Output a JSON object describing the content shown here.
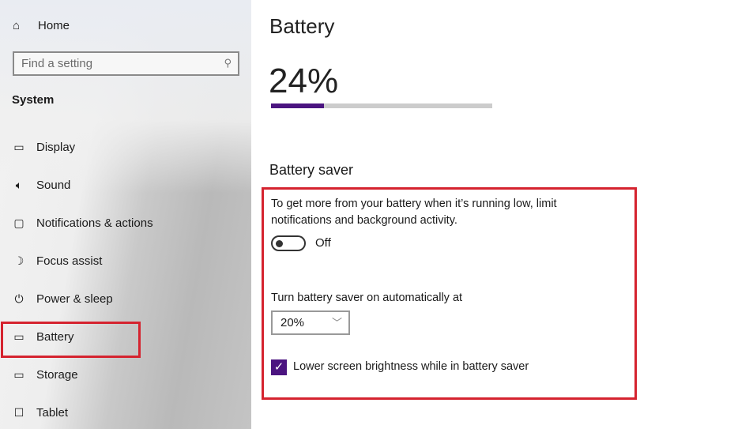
{
  "sidebar": {
    "home": "Home",
    "search_placeholder": "Find a setting",
    "section": "System",
    "items": [
      {
        "label": "Display",
        "icon": "monitor-icon"
      },
      {
        "label": "Sound",
        "icon": "speaker-icon"
      },
      {
        "label": "Notifications & actions",
        "icon": "message-icon"
      },
      {
        "label": "Focus assist",
        "icon": "moon-icon"
      },
      {
        "label": "Power & sleep",
        "icon": "power-icon"
      },
      {
        "label": "Battery",
        "icon": "battery-icon"
      },
      {
        "label": "Storage",
        "icon": "storage-icon"
      },
      {
        "label": "Tablet",
        "icon": "tablet-icon"
      }
    ],
    "selected": "Battery"
  },
  "main": {
    "title": "Battery",
    "battery_percent_label": "24%",
    "battery_level": 0.24,
    "saver_heading": "Battery saver",
    "saver_description": "To get more from your battery when it’s running low, limit notifications and background activity.",
    "toggle_state": "Off",
    "auto_label": "Turn battery saver on automatically at",
    "auto_value": "20%",
    "brightness_label": "Lower screen brightness while in battery saver",
    "brightness_checked": true
  },
  "colors": {
    "accent": "#4b1480",
    "highlight": "#d5232f"
  }
}
